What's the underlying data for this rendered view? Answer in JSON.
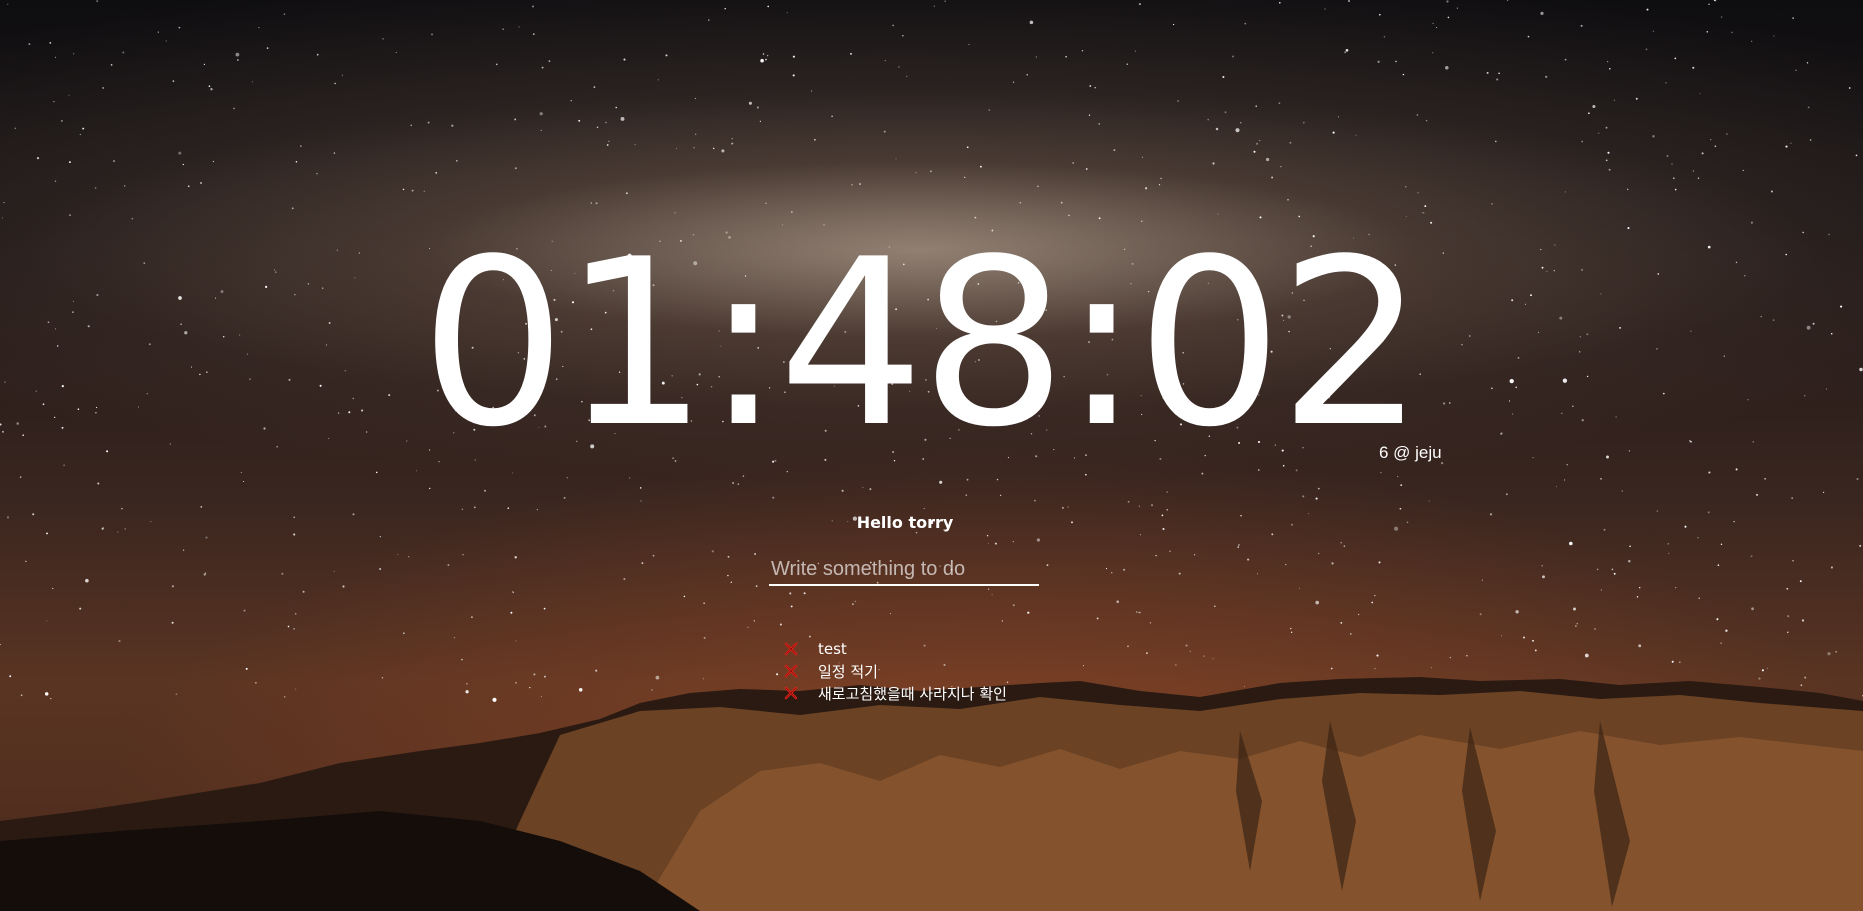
{
  "clock": {
    "time": "01:48:02"
  },
  "weather": {
    "text": "6 @ jeju"
  },
  "greeting": {
    "text": "Hello torry"
  },
  "todo": {
    "placeholder": "Write something to do",
    "value": "",
    "delete_icon": "red-x-icon",
    "items": [
      {
        "text": "test"
      },
      {
        "text": "일정 적기"
      },
      {
        "text": "새로고침했을때 사라지나 확인"
      }
    ]
  },
  "colors": {
    "text": "#ffffff",
    "delete_icon": "#e0241b"
  }
}
